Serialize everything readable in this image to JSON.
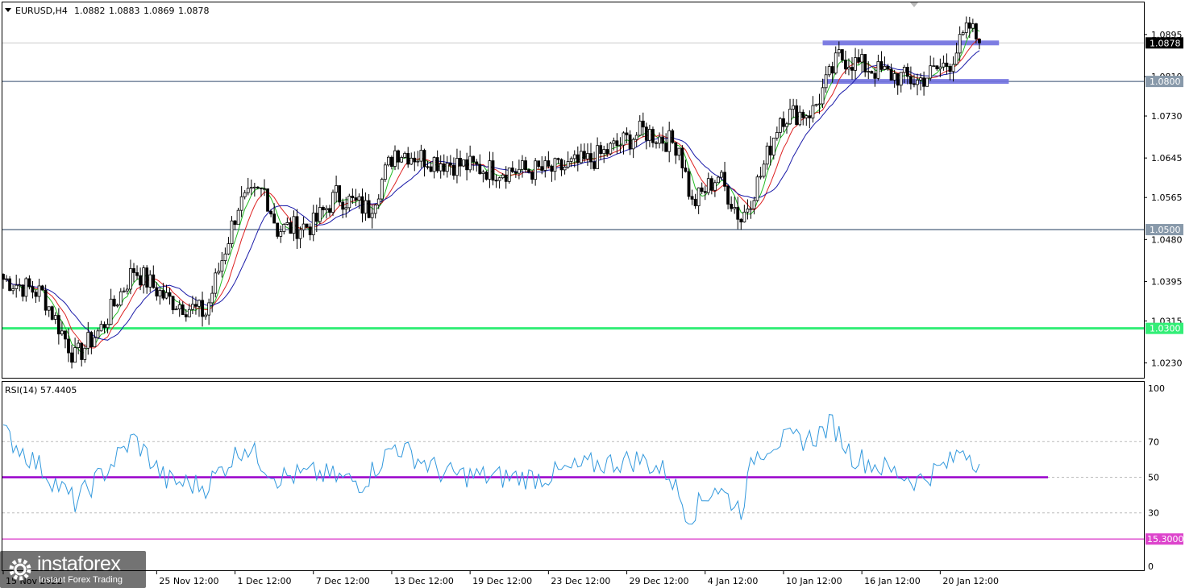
{
  "header": {
    "symbol": "EURUSD,H4",
    "open": "1.0882",
    "high": "1.0883",
    "low": "1.0869",
    "close": "1.0878"
  },
  "rsi_label": "RSI(14) 57.4405",
  "colors": {
    "bull": "#ffffff",
    "bear": "#000000",
    "ma_fast": "#22bb22",
    "ma_mid": "#dd2222",
    "ma_slow": "#1a1aa8",
    "support_line": "#33ee77",
    "level_line": "#5a6e88",
    "zone": "#7070e0",
    "rsi_line": "#3399dd",
    "rsi_mid": "#9900cc",
    "rsi_level": "#dd44cc"
  },
  "price_axis": {
    "ticks": [
      "1.0895",
      "1.0810",
      "1.0730",
      "1.0645",
      "1.0565",
      "1.0480",
      "1.0395",
      "1.0315",
      "1.0230"
    ],
    "tags": [
      {
        "text": "1.0878",
        "value": 1.0878,
        "bg": "#000000"
      },
      {
        "text": "1.0800",
        "value": 1.08,
        "bg": "#8899aa"
      },
      {
        "text": "1.0500",
        "value": 1.05,
        "bg": "#8899aa"
      },
      {
        "text": "1.0300",
        "value": 1.03,
        "bg": "#33ee77"
      }
    ]
  },
  "rsi_axis": {
    "ticks": [
      "100",
      "70",
      "50",
      "30",
      "0"
    ],
    "tag": {
      "text": "15.3000",
      "value": 15.3,
      "bg": "#dd44cc"
    }
  },
  "time_axis": {
    "labels": [
      "15 Nov 2022",
      "25 Nov 12:00",
      "1 Dec 12:00",
      "7 Dec 12:00",
      "13 Dec 12:00",
      "19 Dec 12:00",
      "23 Dec 12:00",
      "29 Dec 12:00",
      "4 Jan 12:00",
      "10 Jan 12:00",
      "16 Jan 12:00",
      "20 Jan 12:00"
    ]
  },
  "logo": {
    "brand": "instaforex",
    "tagline": "Instant Forex Trading"
  },
  "chart_data": [
    {
      "type": "candlestick",
      "title": "EURUSD,H4",
      "ylim": [
        1.02,
        1.096
      ],
      "y_ticks": [
        1.0895,
        1.081,
        1.073,
        1.0645,
        1.0565,
        1.048,
        1.0395,
        1.0315,
        1.023
      ],
      "close_path": [
        {
          "i": 0,
          "close": 1.04
        },
        {
          "i": 12,
          "close": 1.037
        },
        {
          "i": 22,
          "close": 1.024
        },
        {
          "i": 30,
          "close": 1.03
        },
        {
          "i": 40,
          "close": 1.042
        },
        {
          "i": 50,
          "close": 1.036
        },
        {
          "i": 62,
          "close": 1.033
        },
        {
          "i": 72,
          "close": 1.055
        },
        {
          "i": 80,
          "close": 1.058
        },
        {
          "i": 84,
          "close": 1.05
        },
        {
          "i": 95,
          "close": 1.051
        },
        {
          "i": 102,
          "close": 1.057
        },
        {
          "i": 112,
          "close": 1.054
        },
        {
          "i": 120,
          "close": 1.066
        },
        {
          "i": 132,
          "close": 1.064
        },
        {
          "i": 150,
          "close": 1.062
        },
        {
          "i": 168,
          "close": 1.062
        },
        {
          "i": 180,
          "close": 1.064
        },
        {
          "i": 196,
          "close": 1.07
        },
        {
          "i": 207,
          "close": 1.067
        },
        {
          "i": 211,
          "close": 1.055
        },
        {
          "i": 219,
          "close": 1.061
        },
        {
          "i": 226,
          "close": 1.052
        },
        {
          "i": 232,
          "close": 1.061
        },
        {
          "i": 238,
          "close": 1.073
        },
        {
          "i": 248,
          "close": 1.074
        },
        {
          "i": 256,
          "close": 1.085
        },
        {
          "i": 268,
          "close": 1.082
        },
        {
          "i": 280,
          "close": 1.08
        },
        {
          "i": 290,
          "close": 1.084
        },
        {
          "i": 296,
          "close": 1.091
        },
        {
          "i": 299,
          "close": 1.0878
        }
      ],
      "horizontal_levels": [
        {
          "value": 1.03,
          "style": "support"
        },
        {
          "value": 1.05,
          "style": "level"
        },
        {
          "value": 1.08,
          "style": "level"
        }
      ],
      "zones": [
        {
          "value": 1.0878,
          "from_label": "10 Jan 12:00"
        },
        {
          "value": 1.08,
          "from_label": "10 Jan 12:00"
        }
      ]
    },
    {
      "type": "line",
      "title": "RSI(14) 57.4405",
      "ylim": [
        0,
        100
      ],
      "levels": [
        70,
        50,
        30,
        15.3
      ],
      "path": [
        {
          "i": 0,
          "v": 75
        },
        {
          "i": 10,
          "v": 58
        },
        {
          "i": 22,
          "v": 36
        },
        {
          "i": 32,
          "v": 55
        },
        {
          "i": 40,
          "v": 72
        },
        {
          "i": 50,
          "v": 48
        },
        {
          "i": 62,
          "v": 45
        },
        {
          "i": 74,
          "v": 68
        },
        {
          "i": 84,
          "v": 50
        },
        {
          "i": 96,
          "v": 52
        },
        {
          "i": 110,
          "v": 47
        },
        {
          "i": 120,
          "v": 68
        },
        {
          "i": 135,
          "v": 52
        },
        {
          "i": 150,
          "v": 50
        },
        {
          "i": 165,
          "v": 50
        },
        {
          "i": 180,
          "v": 57
        },
        {
          "i": 195,
          "v": 60
        },
        {
          "i": 204,
          "v": 52
        },
        {
          "i": 210,
          "v": 28
        },
        {
          "i": 218,
          "v": 45
        },
        {
          "i": 226,
          "v": 32
        },
        {
          "i": 230,
          "v": 62
        },
        {
          "i": 236,
          "v": 70
        },
        {
          "i": 248,
          "v": 72
        },
        {
          "i": 254,
          "v": 80
        },
        {
          "i": 260,
          "v": 62
        },
        {
          "i": 270,
          "v": 55
        },
        {
          "i": 280,
          "v": 48
        },
        {
          "i": 290,
          "v": 58
        },
        {
          "i": 294,
          "v": 67
        },
        {
          "i": 299,
          "v": 57.44
        }
      ]
    }
  ]
}
